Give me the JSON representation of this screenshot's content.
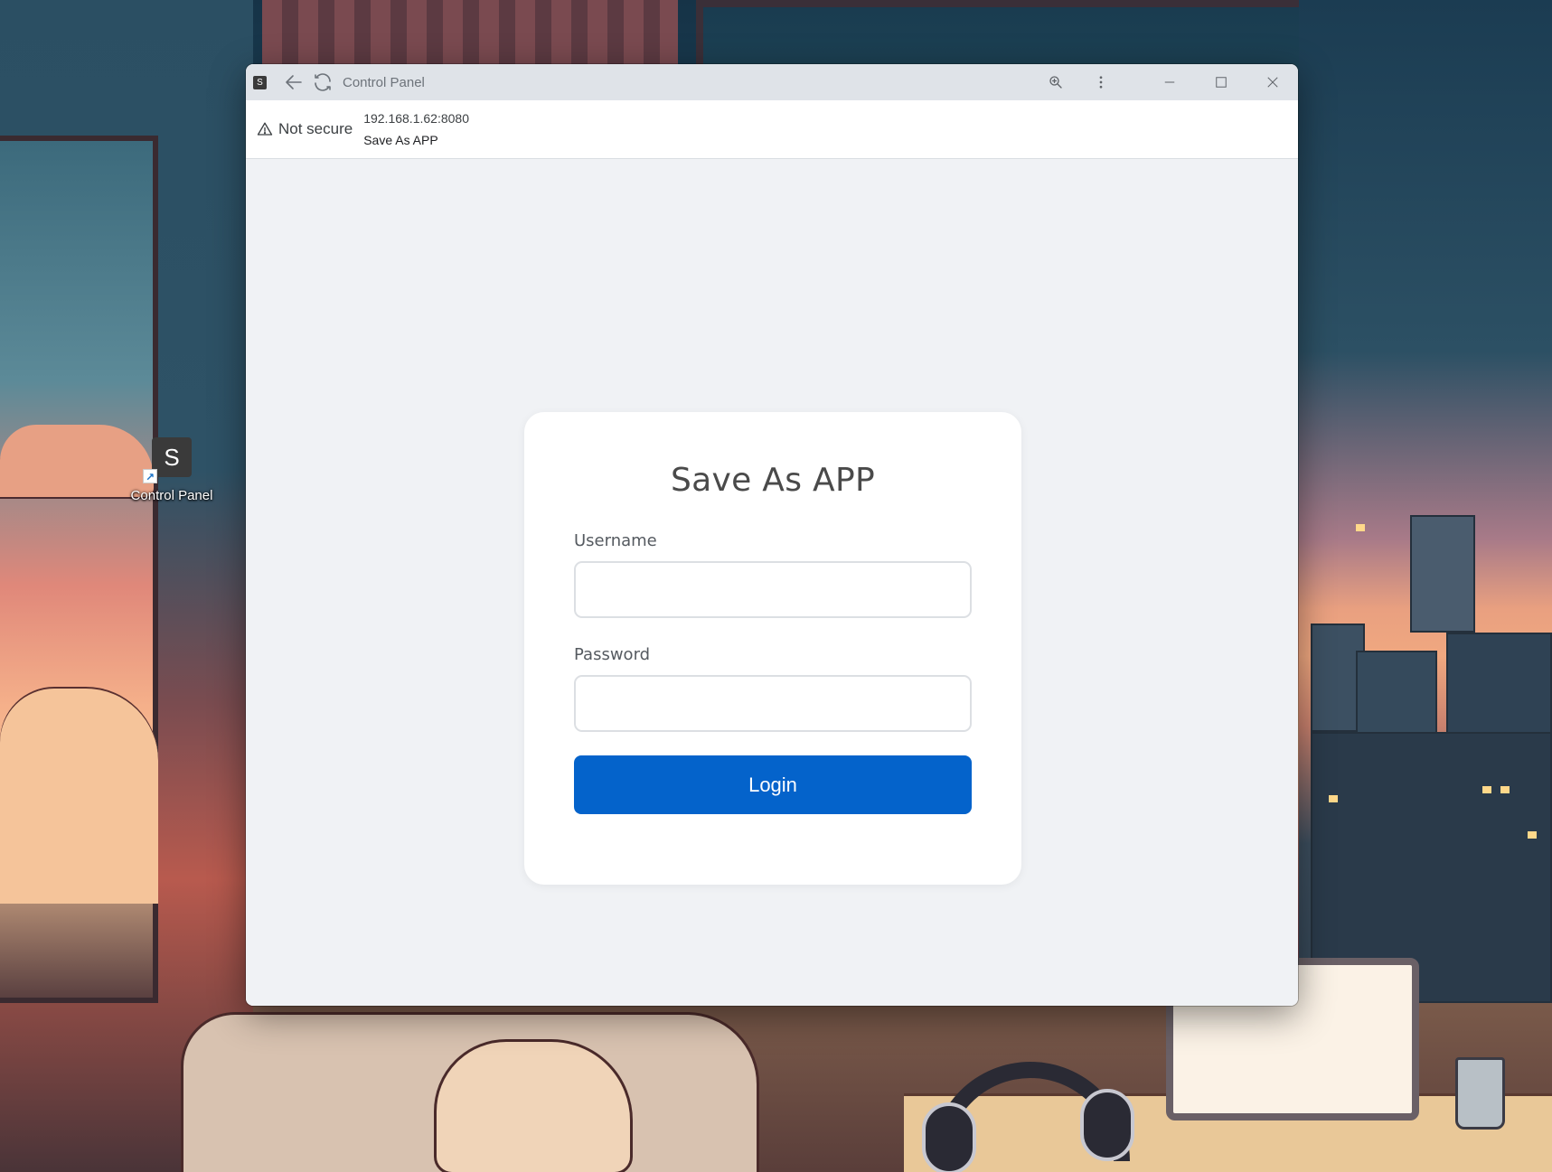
{
  "desktop": {
    "shortcut": {
      "label": "Control Panel",
      "tile_letter": "S",
      "icon": "app-s-icon",
      "overlay_icon": "shortcut-arrow-icon"
    }
  },
  "window": {
    "app_icon_letter": "S",
    "title": "Control Panel",
    "toolbar": {
      "back_icon": "arrow-left-icon",
      "reload_icon": "reload-icon",
      "zoom_icon": "zoom-in-icon",
      "menu_icon": "more-vertical-icon",
      "minimize_icon": "minimize-icon",
      "maximize_icon": "maximize-icon",
      "close_icon": "close-icon"
    },
    "address": {
      "security_label": "Not secure",
      "security_icon": "warning-triangle-icon",
      "url": "192.168.1.62:8080",
      "page_title": "Save As APP"
    }
  },
  "login": {
    "title": "Save As APP",
    "username_label": "Username",
    "username_value": "",
    "password_label": "Password",
    "password_value": "",
    "button_label": "Login"
  },
  "colors": {
    "primary": "#0463cb",
    "page_bg": "#f0f2f5",
    "card_bg": "#ffffff",
    "titlebar_bg": "#dfe3e8"
  }
}
